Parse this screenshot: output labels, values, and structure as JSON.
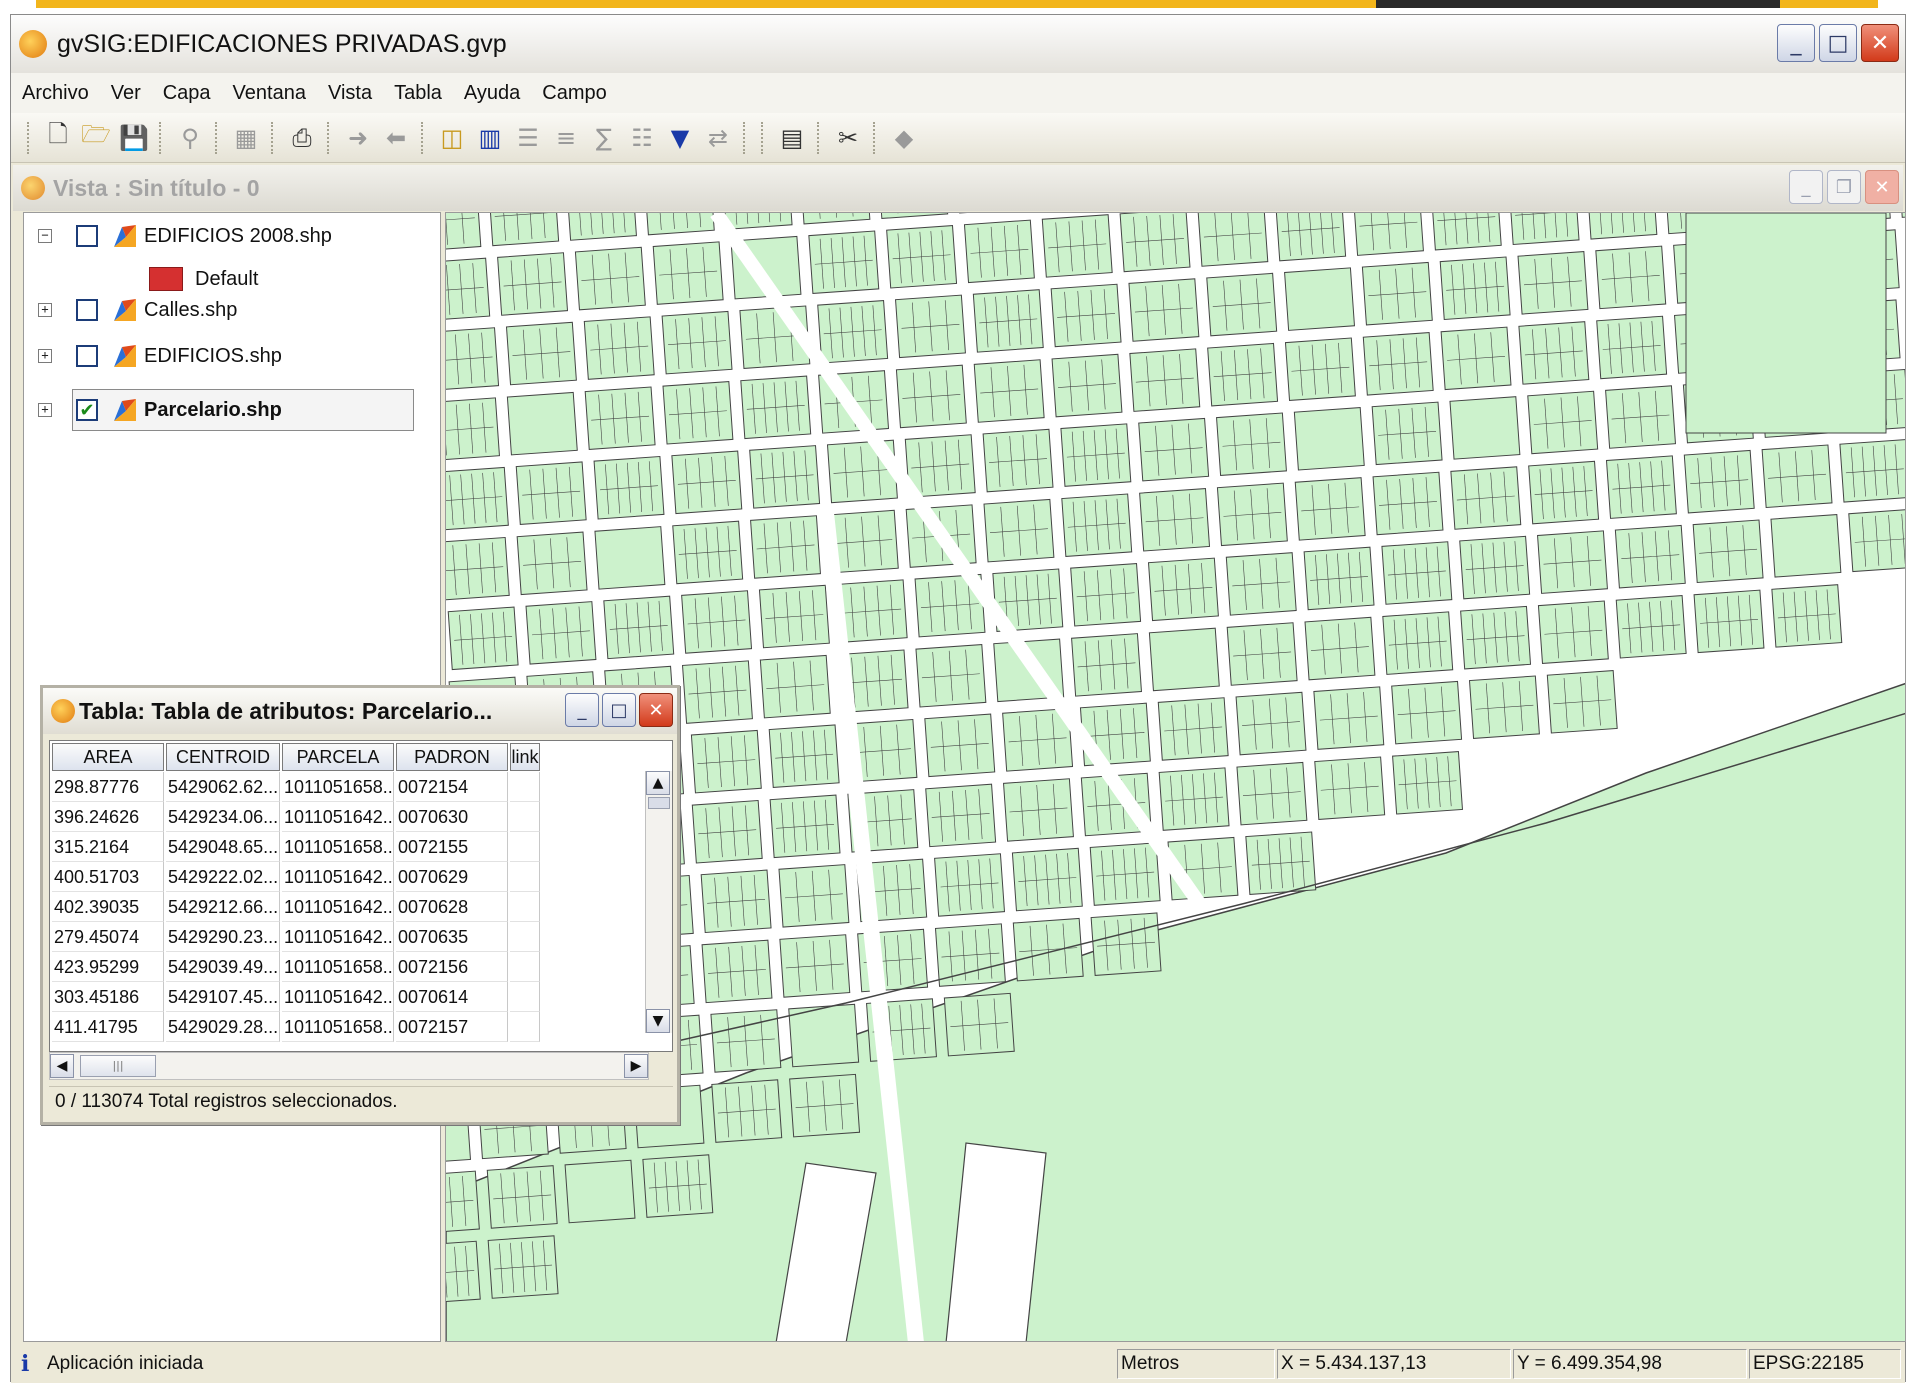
{
  "window": {
    "title": "gvSIG:EDIFICACIONES PRIVADAS.gvp"
  },
  "menu": [
    "Archivo",
    "Ver",
    "Capa",
    "Ventana",
    "Vista",
    "Tabla",
    "Ayuda",
    "Campo"
  ],
  "toolbar": {
    "icons": [
      "new-icon",
      "open-icon",
      "save-icon",
      "zoom-select-icon",
      "table-icon",
      "print-icon",
      "arrow-right-icon",
      "arrow-left-icon",
      "select-icon",
      "table-columns-icon",
      "sort-asc-icon",
      "sort-desc-icon",
      "sum-icon",
      "list-icon",
      "filter-icon",
      "swap-icon",
      "map-frame-icon",
      "tools-icon",
      "eraser-icon"
    ]
  },
  "vista": {
    "title": "Vista : Sin título - 0"
  },
  "toc": {
    "layers": [
      {
        "name": "EDIFICIOS 2008.shp",
        "checked": false,
        "expanded": true,
        "legend": "Default",
        "legend_color": "#d53030"
      },
      {
        "name": "Calles.shp",
        "checked": false,
        "expanded": false
      },
      {
        "name": "EDIFICIOS.shp",
        "checked": false,
        "expanded": false
      },
      {
        "name": "Parcelario.shp",
        "checked": true,
        "expanded": false,
        "selected": true
      }
    ]
  },
  "map": {
    "fill_color": "#ccf2cc",
    "stroke_color": "#444444"
  },
  "tabla": {
    "title": "Tabla: Tabla de atributos: Parcelario...",
    "columns": [
      "AREA",
      "CENTROID",
      "PARCELA",
      "PADRON",
      "link"
    ],
    "rows": [
      [
        "298.87776",
        "5429062.62...",
        "1011051658...",
        "0072154",
        ""
      ],
      [
        "396.24626",
        "5429234.06...",
        "1011051642...",
        "0070630",
        ""
      ],
      [
        "315.2164",
        "5429048.65...",
        "1011051658...",
        "0072155",
        ""
      ],
      [
        "400.51703",
        "5429222.02...",
        "1011051642...",
        "0070629",
        ""
      ],
      [
        "402.39035",
        "5429212.66...",
        "1011051642...",
        "0070628",
        ""
      ],
      [
        "279.45074",
        "5429290.23...",
        "1011051642...",
        "0070635",
        ""
      ],
      [
        "423.95299",
        "5429039.49...",
        "1011051658...",
        "0072156",
        ""
      ],
      [
        "303.45186",
        "5429107.45...",
        "1011051642...",
        "0070614",
        ""
      ],
      [
        "411.41795",
        "5429029.28...",
        "1011051658...",
        "0072157",
        ""
      ]
    ],
    "status": "0 / 113074 Total registros seleccionados."
  },
  "status": {
    "message": "Aplicación iniciada",
    "units": "Metros",
    "x": "X = 5.434.137,13",
    "y": "Y = 6.499.354,98",
    "epsg": "EPSG:22185"
  }
}
